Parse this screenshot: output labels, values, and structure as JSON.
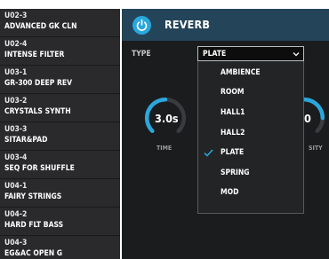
{
  "patches": [
    {
      "code": "U02-3",
      "name": "ADVANCED GK CLN"
    },
    {
      "code": "U02-4",
      "name": "INTENSE FILTER"
    },
    {
      "code": "U03-1",
      "name": "GR-300 DEEP REV"
    },
    {
      "code": "U03-2",
      "name": "CRYSTALS SYNTH"
    },
    {
      "code": "U03-3",
      "name": "SITAR&PAD"
    },
    {
      "code": "U03-4",
      "name": "SEQ FOR SHUFFLE"
    },
    {
      "code": "U04-1",
      "name": "FAIRY STRINGS"
    },
    {
      "code": "U04-2",
      "name": "HARD FLT BASS"
    },
    {
      "code": "U04-3",
      "name": "EG&AC OPEN G"
    }
  ],
  "effect": {
    "title": "REVERB",
    "power_icon": "power-icon",
    "type_label": "TYPE",
    "type_value": "PLATE",
    "time_value": "3.0s",
    "time_label": "TIME",
    "density_value": "0",
    "density_label": "SITY",
    "options": [
      {
        "label": "AMBIENCE",
        "selected": false
      },
      {
        "label": "ROOM",
        "selected": false
      },
      {
        "label": "HALL1",
        "selected": false
      },
      {
        "label": "HALL2",
        "selected": false
      },
      {
        "label": "PLATE",
        "selected": true
      },
      {
        "label": "SPRING",
        "selected": false
      },
      {
        "label": "MOD",
        "selected": false
      }
    ]
  },
  "colors": {
    "accent": "#2aa7dc",
    "header": "#24445a",
    "sidebar": "#2a2a2d",
    "panel": "#1b1c1e"
  }
}
